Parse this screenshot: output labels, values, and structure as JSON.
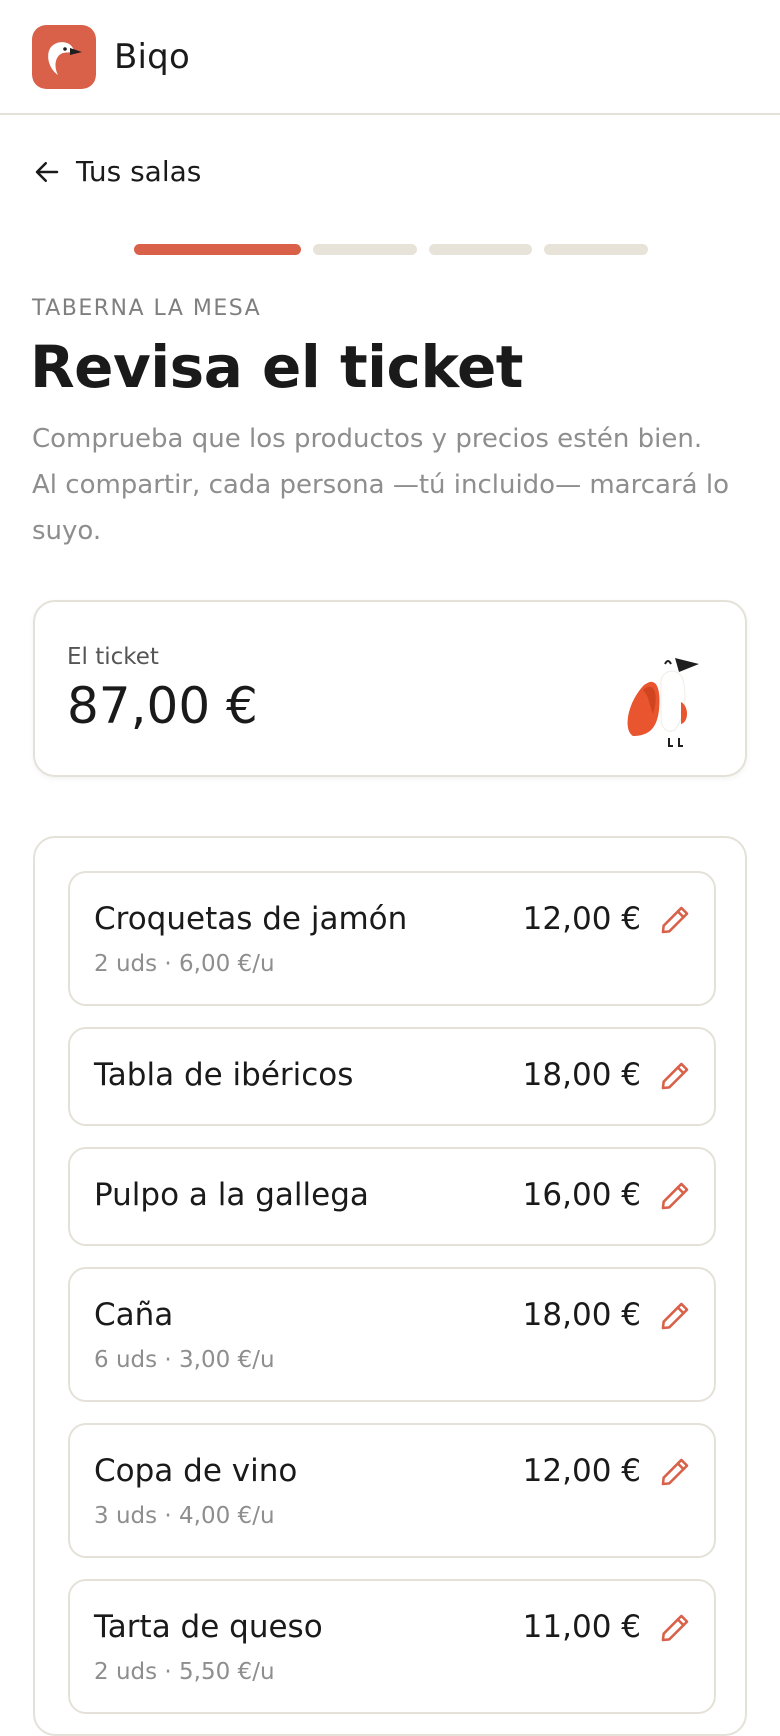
{
  "header": {
    "app_name": "Biqo",
    "logo_icon": "bird-logo-icon",
    "brand_color": "#d9614a"
  },
  "nav": {
    "back_label": "Tus salas",
    "back_icon": "arrow-left-icon"
  },
  "progress": {
    "current_step": 1,
    "total_steps": 4
  },
  "page": {
    "venue": "TABERNA LA MESA",
    "title": "Revisa el ticket",
    "description": "Comprueba que los productos y precios estén bien. Al compartir, cada persona —tú incluido— marcará lo suyo."
  },
  "total_card": {
    "label": "El ticket",
    "amount": "87,00 €",
    "illustration": "bird-mascot-icon"
  },
  "items": [
    {
      "name": "Croquetas de jamón",
      "price": "12,00 €",
      "detail": "2 uds · 6,00 €/u"
    },
    {
      "name": "Tabla de ibéricos",
      "price": "18,00 €",
      "detail": ""
    },
    {
      "name": "Pulpo a la gallega",
      "price": "16,00 €",
      "detail": ""
    },
    {
      "name": "Caña",
      "price": "18,00 €",
      "detail": "6 uds · 3,00 €/u"
    },
    {
      "name": "Copa de vino",
      "price": "12,00 €",
      "detail": "3 uds · 4,00 €/u"
    },
    {
      "name": "Tarta de queso",
      "price": "11,00 €",
      "detail": "2 uds · 5,50 €/u"
    }
  ]
}
